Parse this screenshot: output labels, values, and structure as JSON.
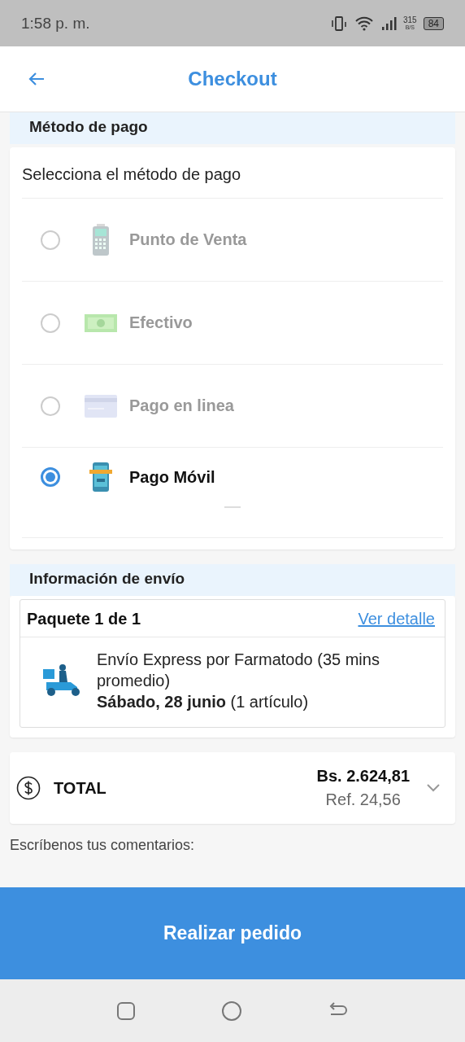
{
  "status_bar": {
    "time": "1:58 p. m.",
    "speed_value": "315",
    "speed_unit": "B/S",
    "battery": "84"
  },
  "header": {
    "title": "Checkout"
  },
  "payment": {
    "section_title": "Método de pago",
    "prompt": "Selecciona el método de pago",
    "methods": [
      {
        "kind": "pos",
        "label": "Punto de Venta",
        "selected": false
      },
      {
        "kind": "cash",
        "label": "Efectivo",
        "selected": false
      },
      {
        "kind": "card",
        "label": "Pago en linea",
        "selected": false
      },
      {
        "kind": "mobile",
        "label": "Pago Móvil",
        "selected": true
      }
    ]
  },
  "shipping": {
    "section_title": "Información de envío",
    "package": "Paquete 1 de 1",
    "detail_link": "Ver detalle",
    "description": "Envío Express por Farmatodo (35 mins promedio)",
    "date_line": "**Sábado, 28 junio** (1 artículo)"
  },
  "total": {
    "label": "TOTAL",
    "amount": "Bs. 2.624,81",
    "ref": "Ref. 24,56"
  },
  "comments": {
    "label": "Escríbenos tus comentarios:"
  },
  "primary_button": "Realizar pedido"
}
